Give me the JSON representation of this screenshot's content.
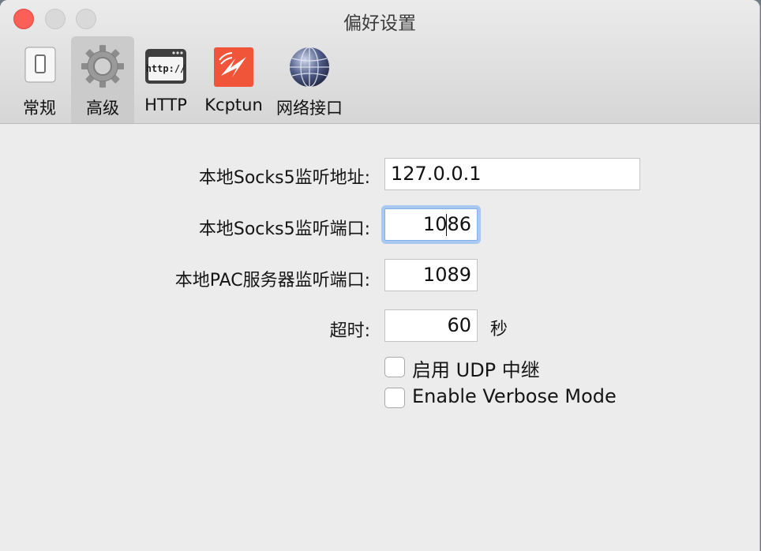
{
  "window": {
    "title": "偏好设置"
  },
  "toolbar": {
    "tabs": [
      {
        "label": "常规",
        "icon": "toggle-switch-icon",
        "selected": false
      },
      {
        "label": "高级",
        "icon": "gear-icon",
        "selected": true
      },
      {
        "label": "HTTP",
        "icon": "http-window-icon",
        "selected": false,
        "icon_text": "http://"
      },
      {
        "label": "Kcptun",
        "icon": "kcptun-icon",
        "selected": false
      },
      {
        "label": "网络接口",
        "icon": "globe-network-icon",
        "selected": false
      }
    ]
  },
  "form": {
    "socks5_address_label": "本地Socks5监听地址:",
    "socks5_address_value": "127.0.0.1",
    "socks5_port_label": "本地Socks5监听端口:",
    "socks5_port_value": "1086",
    "pac_port_label": "本地PAC服务器监听端口:",
    "pac_port_value": "1089",
    "timeout_label": "超时:",
    "timeout_value": "60",
    "timeout_unit": "秒",
    "udp_relay_label": "启用 UDP 中继",
    "udp_relay_checked": false,
    "verbose_label": "Enable Verbose Mode",
    "verbose_checked": false
  },
  "colors": {
    "close": "#fc5f57",
    "focus_ring": "#a7c9f2",
    "selected_tab": "#cbcbcb"
  }
}
